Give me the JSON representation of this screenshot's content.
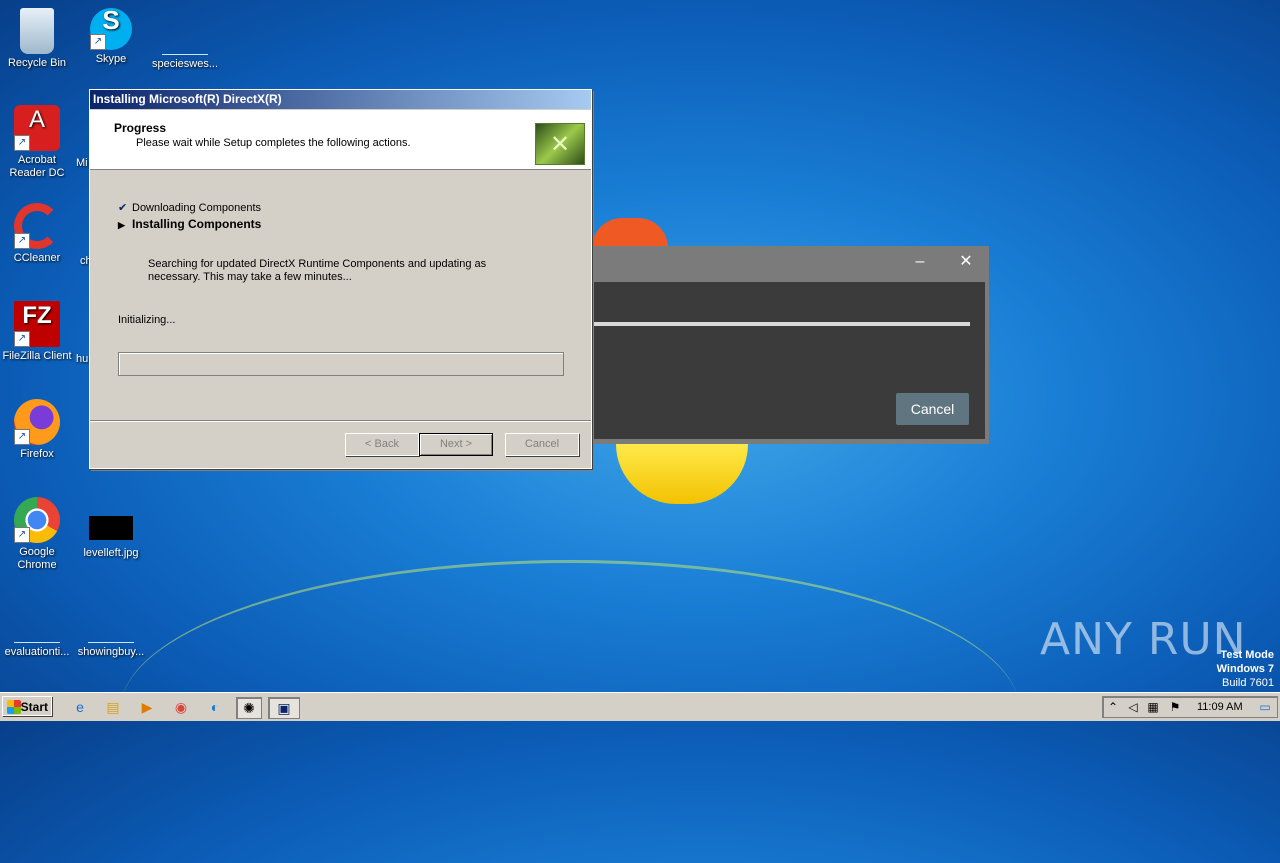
{
  "desktop": {
    "icons": [
      {
        "label": "Recycle Bin",
        "icon": "recycle-bin-icon"
      },
      {
        "label": "Skype",
        "icon": "skype-icon"
      },
      {
        "label": "specieswes...",
        "icon": "file-icon"
      },
      {
        "label": "Acrobat Reader DC",
        "icon": "acrobat-icon"
      },
      {
        "label": "CCleaner",
        "icon": "ccleaner-icon"
      },
      {
        "label": "FileZilla Client",
        "icon": "filezilla-icon"
      },
      {
        "label": "Firefox",
        "icon": "firefox-icon"
      },
      {
        "label": "Google Chrome",
        "icon": "chrome-icon"
      },
      {
        "label": "levelleft.jpg",
        "icon": "image-file-icon"
      },
      {
        "label": "evaluationti...",
        "icon": "file-icon"
      },
      {
        "label": "showingbuy...",
        "icon": "file-icon"
      }
    ],
    "peek_labels": [
      "Mi",
      "ch",
      "hu"
    ]
  },
  "directx": {
    "title": "Installing Microsoft(R) DirectX(R)",
    "header_title": "Progress",
    "header_subtitle": "Please wait while Setup completes the following actions.",
    "steps": [
      {
        "label": "Downloading Components",
        "mark": "✔",
        "state": "done"
      },
      {
        "label": "Installing Components",
        "mark": "▶",
        "state": "current"
      }
    ],
    "description": "Searching for updated DirectX Runtime Components and updating as necessary. This may take a few minutes...",
    "status": "Initializing...",
    "progress": 0,
    "buttons": {
      "back": "< Back",
      "next": "Next >",
      "cancel": "Cancel"
    }
  },
  "dark_dialog": {
    "minimize": "–",
    "close": "✕",
    "progress": 1.0,
    "cancel": "Cancel"
  },
  "watermark": "ANY RUN",
  "test_mode": {
    "line1": "Test Mode",
    "line2": "Windows 7",
    "line3": "Build 7601"
  },
  "taskbar": {
    "start": "Start",
    "items": [
      "ie-icon",
      "explorer-icon",
      "media-player-icon",
      "chrome-icon",
      "edge-icon",
      "app-icon",
      "directx-setup-icon"
    ],
    "clock": "11:09 AM"
  }
}
